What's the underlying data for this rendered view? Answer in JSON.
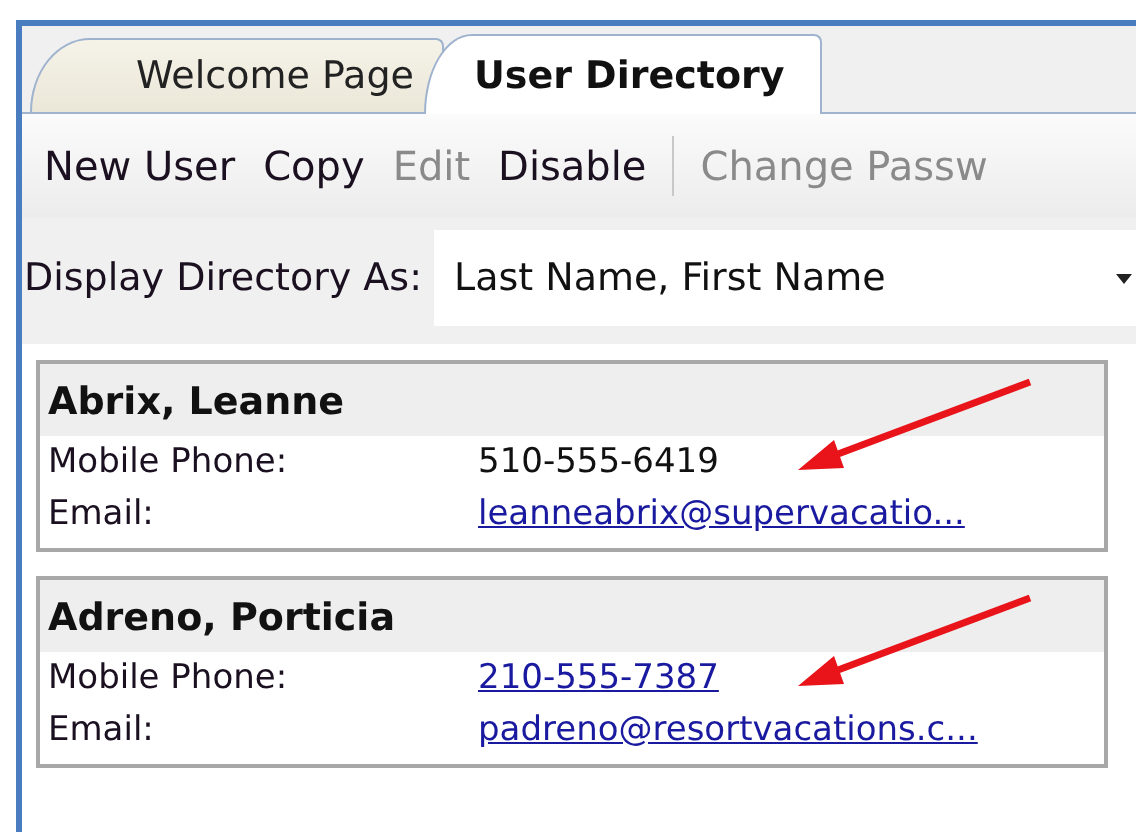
{
  "tabs": [
    {
      "label": "Welcome Page",
      "selected": false
    },
    {
      "label": "User Directory",
      "selected": true
    }
  ],
  "toolbar": [
    {
      "kind": "button",
      "label": "New User",
      "disabled": false
    },
    {
      "kind": "button",
      "label": "Copy",
      "disabled": false
    },
    {
      "kind": "button",
      "label": "Edit",
      "disabled": true
    },
    {
      "kind": "button",
      "label": "Disable",
      "disabled": false
    },
    {
      "kind": "separator"
    },
    {
      "kind": "button",
      "label": "Change Passw",
      "disabled": true
    }
  ],
  "display": {
    "label": "Display Directory As:",
    "value": "Last Name, First Name"
  },
  "users": [
    {
      "name": "Abrix, Leanne",
      "phone_label": "Mobile Phone:",
      "phone": "510-555-6419",
      "phone_link": false,
      "email_label": "Email:",
      "email": "leanneabrix@supervacatio...",
      "arrow": true
    },
    {
      "name": "Adreno, Porticia",
      "phone_label": "Mobile Phone:",
      "phone": "210-555-7387",
      "phone_link": true,
      "email_label": "Email:",
      "email": "padreno@resortvacations.c...",
      "arrow": true
    }
  ]
}
